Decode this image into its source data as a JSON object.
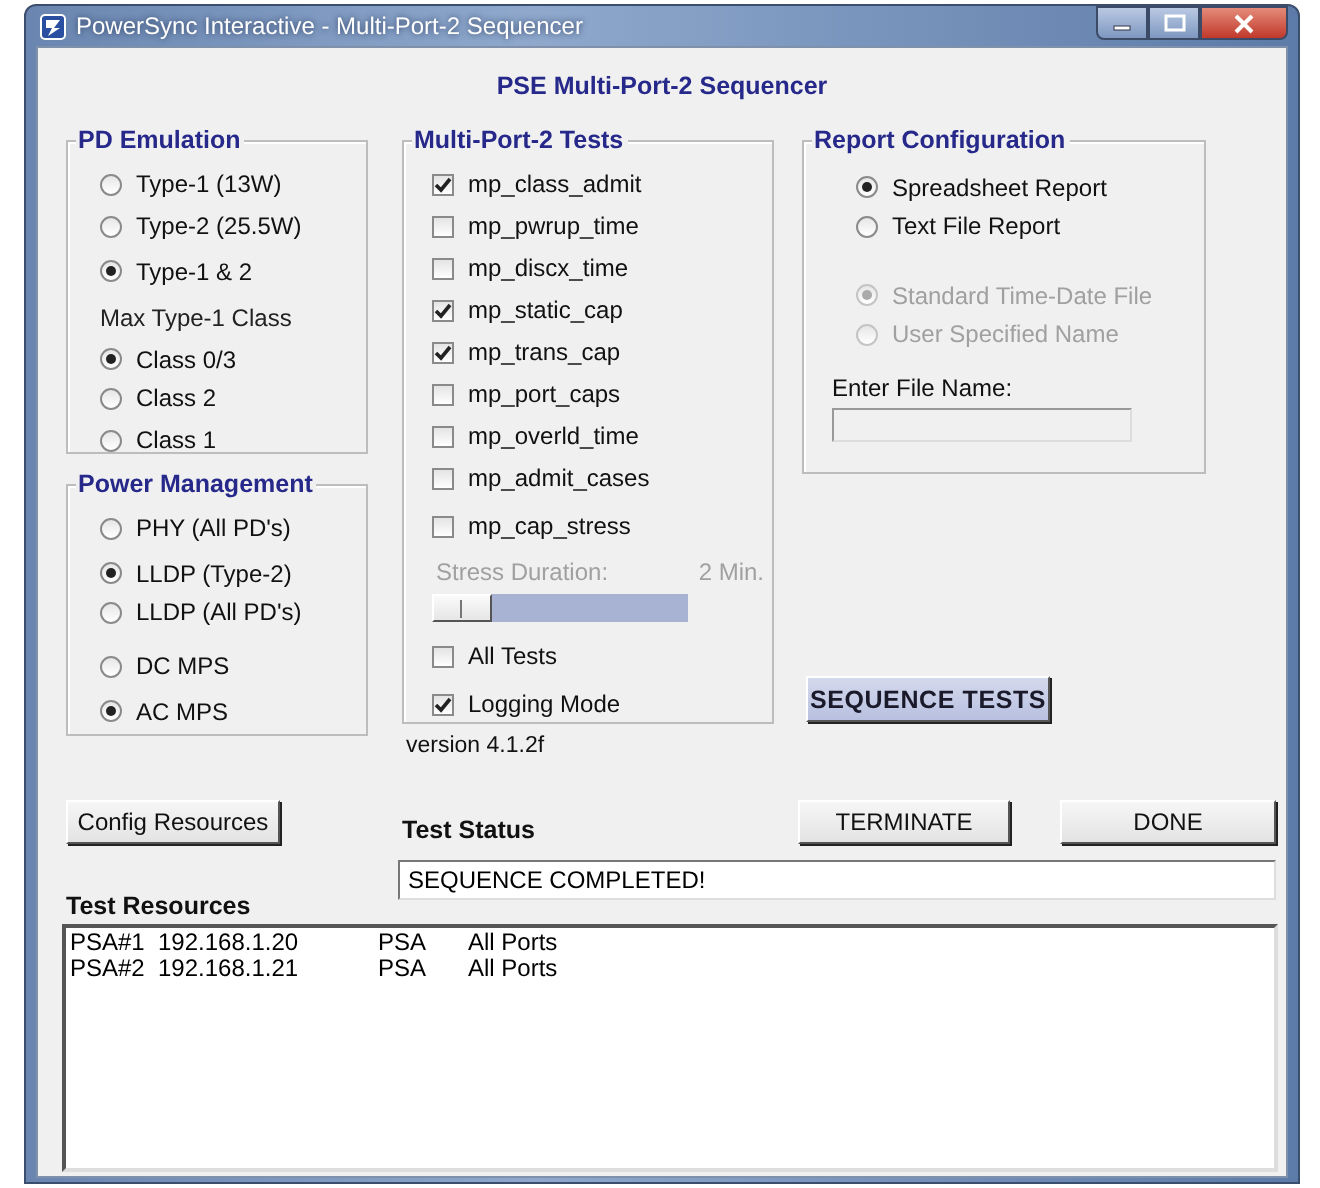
{
  "window": {
    "title": "PowerSync Interactive - Multi-Port-2 Sequencer"
  },
  "heading": "PSE Multi-Port-2 Sequencer",
  "pd_emulation": {
    "title": "PD Emulation",
    "options": [
      {
        "label": "Type-1 (13W)",
        "selected": false
      },
      {
        "label": "Type-2 (25.5W)",
        "selected": false
      },
      {
        "label": "Type-1 & 2",
        "selected": true
      }
    ],
    "class_label": "Max Type-1 Class",
    "class_options": [
      {
        "label": "Class 0/3",
        "selected": true
      },
      {
        "label": "Class 2",
        "selected": false
      },
      {
        "label": "Class 1",
        "selected": false
      }
    ]
  },
  "power_management": {
    "title": "Power Management",
    "options": [
      {
        "label": "PHY (All PD's)",
        "selected": false
      },
      {
        "label": "LLDP (Type-2)",
        "selected": true
      },
      {
        "label": "LLDP (All PD's)",
        "selected": false
      }
    ],
    "mps_options": [
      {
        "label": "DC MPS",
        "selected": false
      },
      {
        "label": "AC MPS",
        "selected": true
      }
    ]
  },
  "tests": {
    "title": "Multi-Port-2 Tests",
    "items": [
      {
        "label": "mp_class_admit",
        "checked": true
      },
      {
        "label": "mp_pwrup_time",
        "checked": false
      },
      {
        "label": "mp_discx_time",
        "checked": false
      },
      {
        "label": "mp_static_cap",
        "checked": true
      },
      {
        "label": "mp_trans_cap",
        "checked": true
      },
      {
        "label": "mp_port_caps",
        "checked": false
      },
      {
        "label": "mp_overld_time",
        "checked": false
      },
      {
        "label": "mp_admit_cases",
        "checked": false
      },
      {
        "label": "mp_cap_stress",
        "checked": false
      }
    ],
    "stress_label": "Stress Duration:",
    "stress_value": "2 Min.",
    "stress_disabled": true,
    "stress_slider": {
      "level": 0
    },
    "all_tests": {
      "label": "All Tests",
      "checked": false
    },
    "logging_mode": {
      "label": "Logging Mode",
      "checked": true
    }
  },
  "version": "version 4.1.2f",
  "report": {
    "title": "Report Configuration",
    "formats": [
      {
        "label": "Spreadsheet Report",
        "selected": true
      },
      {
        "label": "Text File Report",
        "selected": false
      }
    ],
    "naming": [
      {
        "label": "Standard Time-Date File",
        "selected": true,
        "disabled": true
      },
      {
        "label": "User Specified Name",
        "selected": false,
        "disabled": true
      }
    ],
    "file_name_label": "Enter File Name:",
    "file_name": {
      "disabled": true
    }
  },
  "sequence_button": "SEQUENCE TESTS",
  "config_button": "Config Resources",
  "terminate_button": "TERMINATE",
  "done_button": "DONE",
  "status": {
    "label": "Test Status",
    "value": "SEQUENCE COMPLETED!"
  },
  "resources": {
    "label": "Test Resources",
    "rows": [
      {
        "name": "PSA#1",
        "address": "192.168.1.20",
        "type": "PSA",
        "ports": "All Ports"
      },
      {
        "name": "PSA#2",
        "address": "192.168.1.21",
        "type": "PSA",
        "ports": "All Ports"
      }
    ]
  }
}
